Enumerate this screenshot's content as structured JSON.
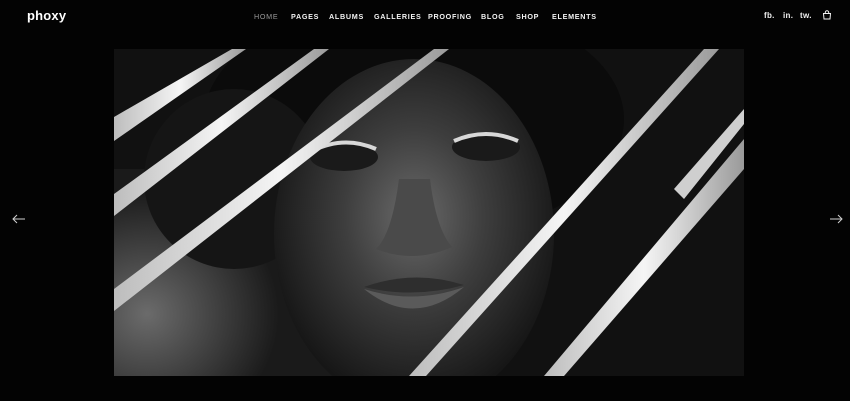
{
  "header": {
    "logo": "phoxy",
    "nav": [
      {
        "label": "HOME",
        "active": true
      },
      {
        "label": "PAGES",
        "active": false
      },
      {
        "label": "ALBUMS",
        "active": false
      },
      {
        "label": "GALLERIES",
        "active": false
      },
      {
        "label": "PROOFING",
        "active": false
      },
      {
        "label": "BLOG",
        "active": false
      },
      {
        "label": "SHOP",
        "active": false
      },
      {
        "label": "ELEMENTS",
        "active": false
      }
    ],
    "social": [
      "fb.",
      "in.",
      "tw."
    ],
    "cart_icon": "shopping-bag-icon"
  },
  "slider": {
    "image_icon": "portrait-photo",
    "prev_icon": "arrow-left-icon",
    "next_icon": "arrow-right-icon"
  },
  "colors": {
    "background": "#030303",
    "text": "#f2f2f2",
    "nav_active": "#9a9a9a"
  }
}
